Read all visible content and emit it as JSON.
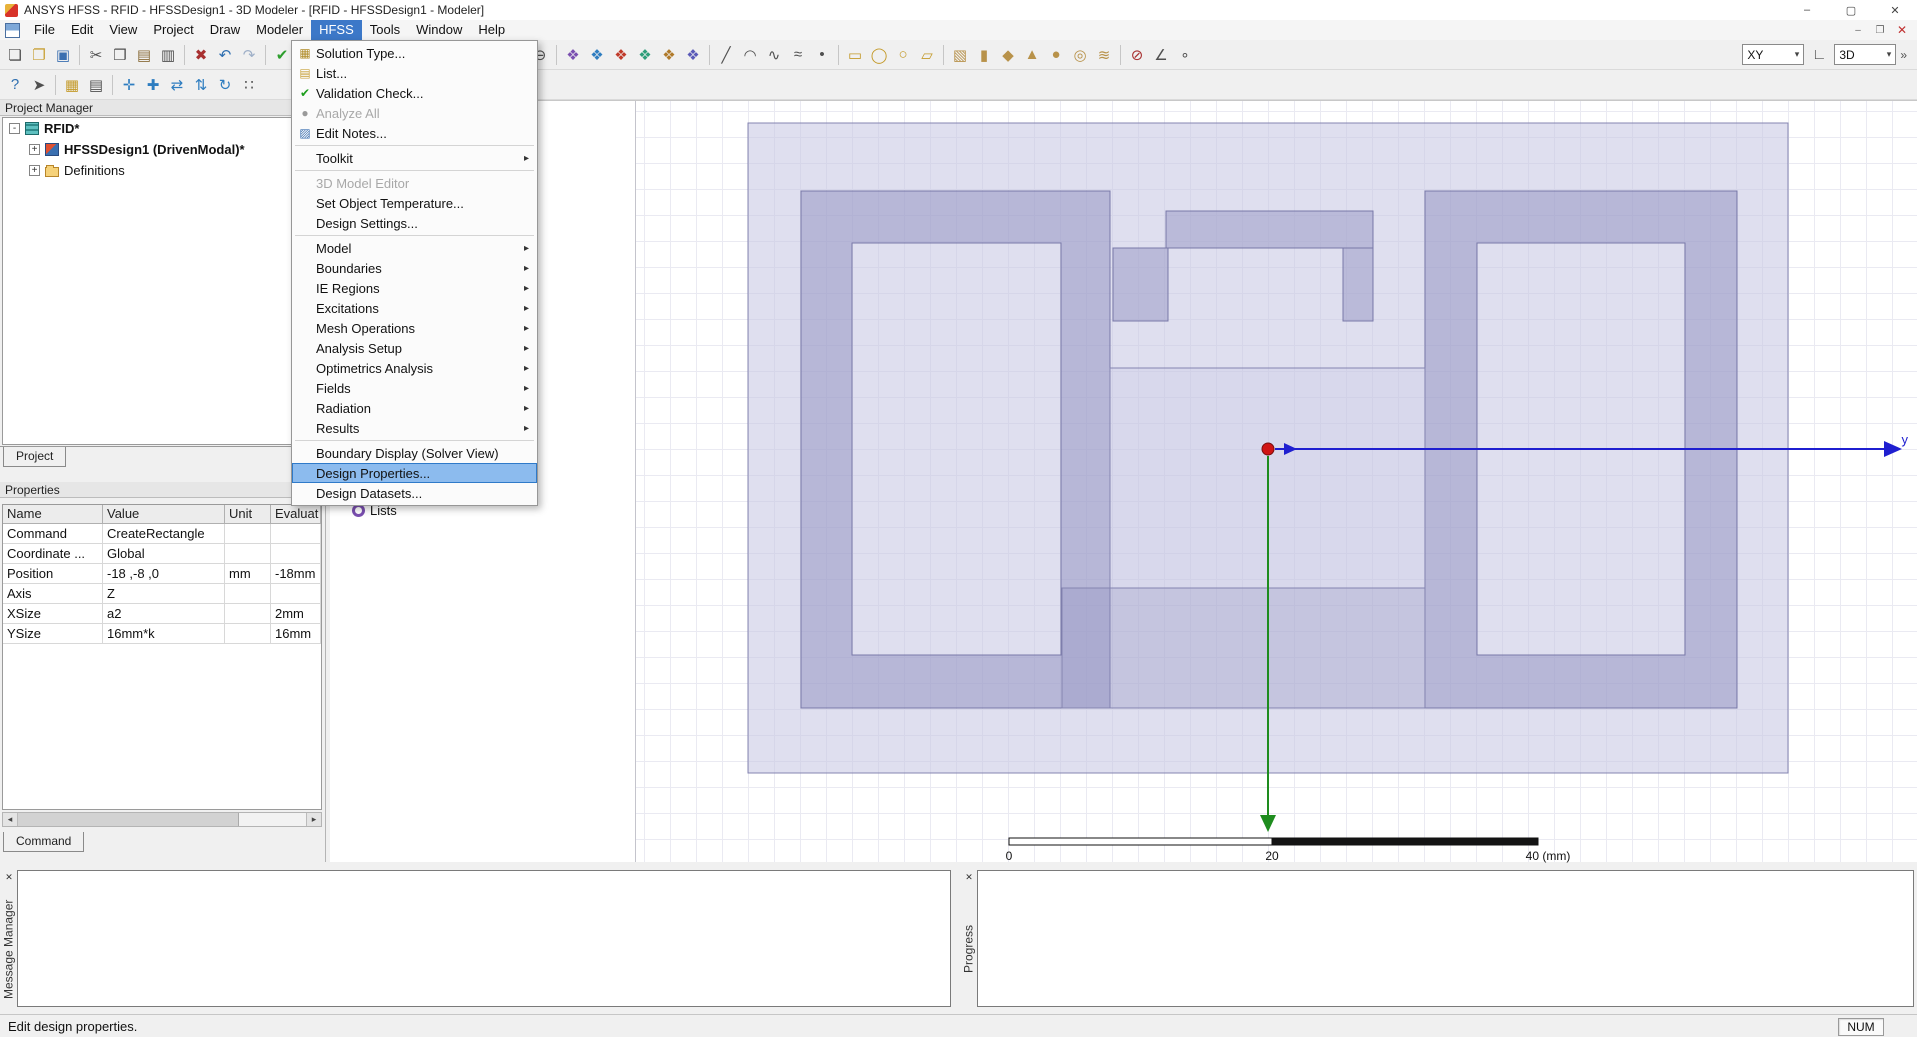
{
  "window": {
    "title": "ANSYS HFSS - RFID - HFSSDesign1 - 3D Modeler - [RFID - HFSSDesign1 - Modeler]",
    "minimize": "–",
    "maximize": "▢",
    "close": "✕"
  },
  "menubar": {
    "items": [
      "File",
      "Edit",
      "View",
      "Project",
      "Draw",
      "Modeler",
      "HFSS",
      "Tools",
      "Window",
      "Help"
    ],
    "active": "HFSS",
    "child_controls": {
      "minimize": "–",
      "restore": "❐",
      "close": "✕"
    }
  },
  "hfss_menu": {
    "submenu_arrow": "▸",
    "items": [
      {
        "label": "Solution Type...",
        "icon": "solution-type-icon",
        "glyph": "▦",
        "color": "#b08c28"
      },
      {
        "label": "List...",
        "icon": "list-icon",
        "glyph": "▤",
        "color": "#c8a23c"
      },
      {
        "label": "Validation Check...",
        "icon": "validation-check-icon",
        "glyph": "✔",
        "color": "#1e9e1e"
      },
      {
        "label": "Analyze All",
        "disabled": true,
        "icon": "analyze-all-icon",
        "glyph": "●",
        "color": "#9a9a9a"
      },
      {
        "label": "Edit Notes...",
        "icon": "edit-notes-icon",
        "glyph": "▨",
        "color": "#3a6fb0",
        "sep_after": true
      },
      {
        "label": "Toolkit",
        "submenu": true,
        "sep_after": true
      },
      {
        "label": "3D Model Editor",
        "disabled": true
      },
      {
        "label": "Set Object Temperature..."
      },
      {
        "label": "Design Settings...",
        "sep_after": true
      },
      {
        "label": "Model",
        "submenu": true
      },
      {
        "label": "Boundaries",
        "submenu": true
      },
      {
        "label": "IE Regions",
        "submenu": true
      },
      {
        "label": "Excitations",
        "submenu": true
      },
      {
        "label": "Mesh Operations",
        "submenu": true
      },
      {
        "label": "Analysis Setup",
        "submenu": true
      },
      {
        "label": "Optimetrics Analysis",
        "submenu": true
      },
      {
        "label": "Fields",
        "submenu": true
      },
      {
        "label": "Radiation",
        "submenu": true
      },
      {
        "label": "Results",
        "submenu": true,
        "sep_after": true
      },
      {
        "label": "Boundary Display (Solver View)"
      },
      {
        "label": "Design Properties...",
        "highlighted": true
      },
      {
        "label": "Design Datasets..."
      }
    ]
  },
  "toolbars": {
    "plane_combo": "XY",
    "mode_combo": "3D",
    "combo_arrow": "▾",
    "overflow": "»",
    "main": [
      {
        "n": "new-file-icon",
        "g": "❏",
        "c": "#505050"
      },
      {
        "n": "open-file-icon",
        "g": "❐",
        "c": "#c9a23a"
      },
      {
        "n": "save-file-icon",
        "g": "▣",
        "c": "#3a6fb0"
      },
      "|",
      {
        "n": "cut-icon",
        "g": "✂",
        "c": "#505050"
      },
      {
        "n": "copy-icon",
        "g": "❒",
        "c": "#505050"
      },
      {
        "n": "paste-icon",
        "g": "▤",
        "c": "#8a6d3b"
      },
      {
        "n": "print-icon",
        "g": "▥",
        "c": "#505050"
      },
      "|",
      {
        "n": "delete-icon",
        "g": "✖",
        "c": "#a83030"
      },
      {
        "n": "undo-icon",
        "g": "↶",
        "c": "#2f6fb0"
      },
      {
        "n": "redo-icon",
        "g": "↷",
        "c": "#9fb0c8"
      },
      "|",
      {
        "n": "validation-check-icon",
        "g": "✔",
        "c": "#2e9e2e"
      },
      {
        "n": "analyze-all-icon",
        "g": "➤",
        "c": "#2e9e2e"
      },
      {
        "n": "edit-notes-icon",
        "g": "▨",
        "c": "#3a6fb0"
      },
      "|",
      {
        "n": "zoom-window-icon",
        "g": "⊡",
        "c": "#505050"
      },
      {
        "n": "fit-all-icon",
        "g": "⊞",
        "c": "#505050"
      },
      "|",
      {
        "n": "pan-icon",
        "g": "✥",
        "c": "#b07a2a"
      },
      {
        "n": "rotate-center-icon",
        "g": "↺",
        "c": "#2e7dc0"
      },
      {
        "n": "rotate-current-axis-icon",
        "g": "↻",
        "c": "#2e7dc0"
      },
      {
        "n": "rotate-screen-center-icon",
        "g": "↺",
        "c": "#2e7dc0"
      },
      {
        "n": "zoom-in-icon",
        "g": "⊕",
        "c": "#505050"
      },
      {
        "n": "zoom-out-icon",
        "g": "⊖",
        "c": "#505050"
      },
      "|",
      {
        "n": "assign-material-icon",
        "g": "❖",
        "c": "#7a4fb0"
      },
      {
        "n": "assign-boundary-icon",
        "g": "❖",
        "c": "#2e7dc0"
      },
      {
        "n": "assign-excitation-icon",
        "g": "❖",
        "c": "#c03a2a"
      },
      {
        "n": "mesh-operations-icon",
        "g": "❖",
        "c": "#2e9e7a"
      },
      {
        "n": "analysis-setup-icon",
        "g": "❖",
        "c": "#b07a2a"
      },
      {
        "n": "optimetrics-setup-icon",
        "g": "❖",
        "c": "#5a5ab8"
      },
      "|",
      {
        "n": "draw-line-icon",
        "g": "╱",
        "c": "#505050"
      },
      {
        "n": "draw-arc-icon",
        "g": "◠",
        "c": "#505050"
      },
      {
        "n": "draw-spline-icon",
        "g": "∿",
        "c": "#505050"
      },
      {
        "n": "draw-equation-curve-icon",
        "g": "≈",
        "c": "#505050"
      },
      {
        "n": "draw-point-icon",
        "g": "•",
        "c": "#505050"
      },
      "|",
      {
        "n": "draw-rectangle-icon",
        "g": "▭",
        "c": "#c49a2a"
      },
      {
        "n": "draw-ellipse-icon",
        "g": "◯",
        "c": "#c49a2a"
      },
      {
        "n": "draw-circle-icon",
        "g": "○",
        "c": "#c49a2a"
      },
      {
        "n": "draw-regular-polygon-icon",
        "g": "▱",
        "c": "#c49a2a"
      },
      "|",
      {
        "n": "draw-box-icon",
        "g": "▧",
        "c": "#b8924a"
      },
      {
        "n": "draw-cylinder-icon",
        "g": "▮",
        "c": "#b8924a"
      },
      {
        "n": "draw-polyhedron-icon",
        "g": "◆",
        "c": "#b8924a"
      },
      {
        "n": "draw-cone-icon",
        "g": "▲",
        "c": "#b8924a"
      },
      {
        "n": "draw-sphere-icon",
        "g": "●",
        "c": "#b8924a"
      },
      {
        "n": "draw-torus-icon",
        "g": "◎",
        "c": "#b8924a"
      },
      {
        "n": "draw-helix-icon",
        "g": "≋",
        "c": "#b8924a"
      },
      "|",
      {
        "n": "boolean-subtract-icon",
        "g": "⊘",
        "c": "#a83030"
      },
      {
        "n": "measure-icon",
        "g": "∠",
        "c": "#505050"
      },
      {
        "n": "snap-mode-icon",
        "g": "∘",
        "c": "#505050"
      }
    ],
    "secondary": [
      {
        "n": "select-help-icon",
        "g": "?",
        "c": "#2f6fb0"
      },
      {
        "n": "whats-this-icon",
        "g": "➤",
        "c": "#505050"
      },
      "|",
      {
        "n": "grid-settings-icon",
        "g": "▦",
        "c": "#c49a2a"
      },
      {
        "n": "snap-settings-icon",
        "g": "▤",
        "c": "#505050"
      },
      "|",
      {
        "n": "move-cs-icon",
        "g": "✛",
        "c": "#2e7dc0"
      },
      {
        "n": "offset-cs-icon",
        "g": "✚",
        "c": "#2e7dc0"
      },
      {
        "n": "align-horizontal-icon",
        "g": "⇄",
        "c": "#2e7dc0"
      },
      {
        "n": "align-vertical-icon",
        "g": "⇅",
        "c": "#2e7dc0"
      },
      {
        "n": "rotate-cs-icon",
        "g": "↻",
        "c": "#2e7dc0"
      },
      {
        "n": "measure-position-icon",
        "g": "∷",
        "c": "#505050"
      }
    ]
  },
  "project_manager": {
    "title": "Project Manager",
    "tab": "Project",
    "tree": [
      {
        "label": "RFID*",
        "level": 0,
        "expander": "-",
        "icon": "project-icon",
        "bold": true
      },
      {
        "label": "HFSSDesign1 (DrivenModal)*",
        "level": 1,
        "expander": "+",
        "icon": "design-icon",
        "bold": true
      },
      {
        "label": "Definitions",
        "level": 1,
        "expander": "+",
        "icon": "folder-icon",
        "bold": false
      }
    ]
  },
  "properties": {
    "title": "Properties",
    "tab": "Command",
    "columns": [
      "Name",
      "Value",
      "Unit",
      "Evaluat"
    ],
    "rows": [
      [
        "Command",
        "CreateRectangle",
        "",
        ""
      ],
      [
        "Coordinate ...",
        "Global",
        "",
        ""
      ],
      [
        "Position",
        "-18 ,-8 ,0",
        "mm",
        "-18mm"
      ],
      [
        "Axis",
        "Z",
        "",
        ""
      ],
      [
        "XSize",
        "a2",
        "",
        "2mm"
      ],
      [
        "YSize",
        "16mm*k",
        "",
        "16mm"
      ]
    ],
    "scroll_left": "◂",
    "scroll_right": "▸"
  },
  "modeler": {
    "tree_item": "Lists",
    "ruler": {
      "zero": "0",
      "twenty": "20",
      "forty": "40 (mm)"
    },
    "axis_y_label": "y",
    "colors": {
      "axis_y": "#1f1fd0",
      "axis_x": "#1e8c1e",
      "origin": "#d01414",
      "outline": "#8080ac"
    }
  },
  "panels": {
    "message_manager": {
      "label": "Message Manager",
      "close": "✕"
    },
    "progress": {
      "label": "Progress",
      "close": "✕"
    }
  },
  "statusbar": {
    "text": "Edit design properties.",
    "num": "NUM"
  }
}
